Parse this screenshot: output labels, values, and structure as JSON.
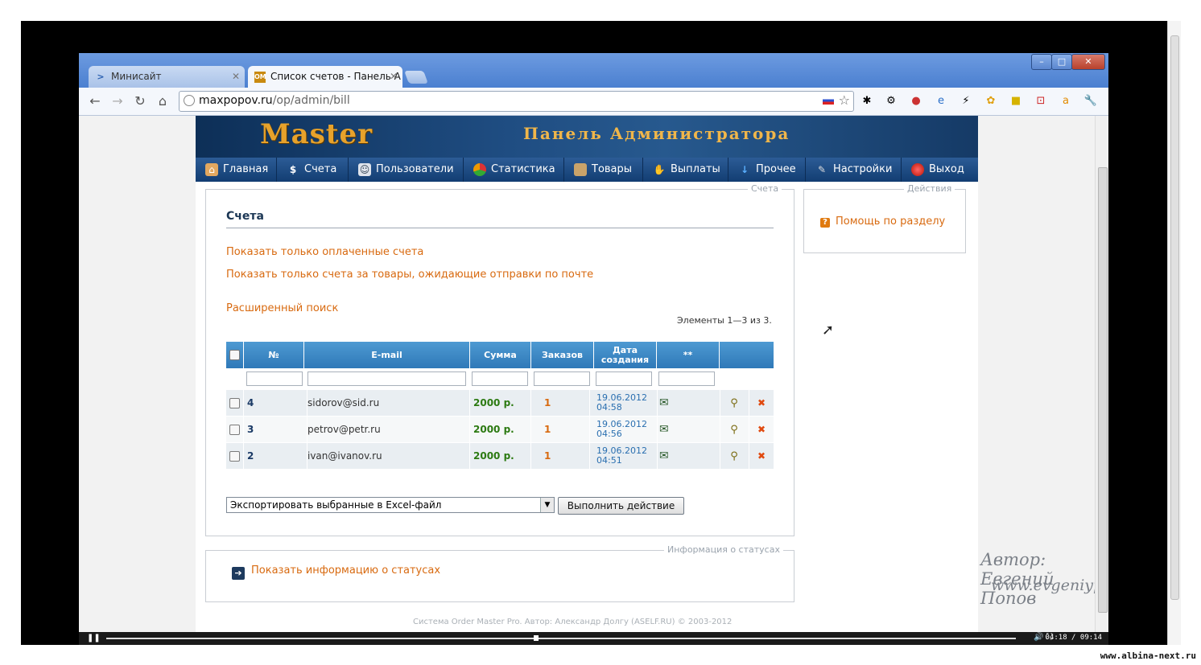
{
  "browser": {
    "tabs": [
      {
        "label": "Минисайт",
        "icon": "chevron-icon"
      },
      {
        "label": "Список счетов - Панель А",
        "icon": "om-favicon"
      }
    ],
    "window_buttons": [
      "–",
      "□",
      "✕"
    ],
    "url_host": "maxpopov.ru",
    "url_path": "/op/admin/bill"
  },
  "site": {
    "logo": "Master",
    "panel_title": "Панель Администратора",
    "nav": [
      {
        "label": "Главная",
        "icon": "home-icon"
      },
      {
        "label": "Счета",
        "icon": "dollar-icon"
      },
      {
        "label": "Пользователи",
        "icon": "users-icon"
      },
      {
        "label": "Статистика",
        "icon": "pie-chart-icon"
      },
      {
        "label": "Товары",
        "icon": "box-icon"
      },
      {
        "label": "Выплаты",
        "icon": "payout-icon"
      },
      {
        "label": "Прочее",
        "icon": "arrow-down-icon"
      },
      {
        "label": "Настройки",
        "icon": "wrench-icon"
      },
      {
        "label": "Выход",
        "icon": "exit-icon"
      }
    ]
  },
  "main": {
    "legend": "Счета",
    "title": "Счета",
    "links": [
      "Показать только оплаченные счета",
      "Показать только счета за товары, ожидающие отправки по почте"
    ],
    "advanced_search": "Расширенный поиск",
    "counter": "Элементы 1—3 из 3.",
    "columns": {
      "num": "№",
      "email": "E-mail",
      "sum": "Сумма",
      "orders": "Заказов",
      "date_line1": "Дата",
      "date_line2": "создания",
      "extra": "**"
    },
    "rows": [
      {
        "id": "4",
        "email": "sidorov@sid.ru",
        "sum": "2000 р.",
        "orders": "1",
        "date": "19.06.2012",
        "time": "04:58"
      },
      {
        "id": "3",
        "email": "petrov@petr.ru",
        "sum": "2000 р.",
        "orders": "1",
        "date": "19.06.2012",
        "time": "04:56"
      },
      {
        "id": "2",
        "email": "ivan@ivanov.ru",
        "sum": "2000 р.",
        "orders": "1",
        "date": "19.06.2012",
        "time": "04:51"
      }
    ],
    "bulk_action": "Экспортировать выбранные в Excel-файл",
    "run_button": "Выполнить действие"
  },
  "status_info": {
    "legend": "Информация о статусах",
    "link": "Показать информацию о статусах"
  },
  "actions": {
    "legend": "Действия",
    "help_link": "Помощь по разделу"
  },
  "footer": "Система Order Master Pro. Автор: Александр Долгу (ASELF.RU) © 2003-2012",
  "watermark": {
    "author": "Автор: Евгений Попов",
    "site": "www.evgeniypopov.com",
    "corner_site": "www.albina-next.ru"
  },
  "player": {
    "time": "04:18 / 09:14",
    "progress": 0.47
  },
  "colors": {
    "link": "#d86a10",
    "header_blue": "#2f79b8",
    "sum_green": "#2c7a12",
    "date_blue": "#2a6fb0"
  }
}
